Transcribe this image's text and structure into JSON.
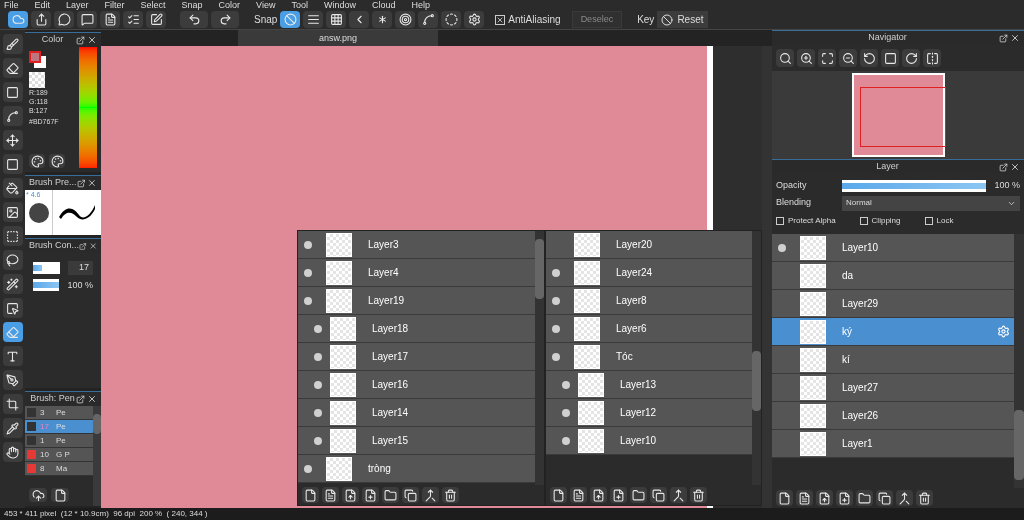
{
  "menu": [
    "File",
    "Edit",
    "Layer",
    "Filter",
    "Select",
    "Snap",
    "Color",
    "View",
    "Tool",
    "Window",
    "Cloud",
    "Help"
  ],
  "toolbar": {
    "snap_label": "Snap",
    "snap_modes": [
      {
        "selected": true
      },
      {
        "selected": false
      },
      {
        "selected": false
      },
      {
        "selected": false
      },
      {
        "selected": false
      },
      {
        "selected": false
      },
      {
        "selected": false
      },
      {
        "selected": false
      },
      {
        "selected": false
      }
    ],
    "antialiasing": {
      "label": "AntiAliasing",
      "checked": true
    },
    "deselect": {
      "label": "Deselec",
      "disabled": true
    },
    "key_label": "Key",
    "reset": "Reset"
  },
  "document_tab": {
    "title": "answ.png"
  },
  "tools": [
    {
      "selected": false
    },
    {
      "selected": false
    },
    {
      "selected": false
    },
    {
      "selected": false
    },
    {
      "selected": false
    },
    {
      "selected": false
    },
    {
      "selected": false
    },
    {
      "selected": false
    },
    {
      "selected": false
    },
    {
      "selected": false
    },
    {
      "selected": false
    },
    {
      "selected": false
    },
    {
      "selected": true
    },
    {
      "selected": false
    },
    {
      "selected": false
    },
    {
      "selected": false
    },
    {
      "selected": false
    },
    {
      "selected": false
    }
  ],
  "color_panel": {
    "title": "Color",
    "r": "R:189",
    "g": "G:118",
    "b": "B:127",
    "hex": "#BD767F"
  },
  "brush_preview": {
    "title": "Brush Pre...",
    "size": "* 4.6"
  },
  "brush_control": {
    "title": "Brush Con...",
    "size": {
      "value": "17",
      "level": 0.35
    },
    "opacity": {
      "value": "100 %",
      "level": 1
    }
  },
  "brush_list": {
    "title": "Brush: Pen",
    "items": [
      {
        "size": "3",
        "name": "Pe",
        "color": "#333333",
        "selected": false
      },
      {
        "size": "17",
        "name": "Pe",
        "color": "#333333",
        "selected": true
      },
      {
        "size": "1",
        "name": "Pe",
        "color": "#333333",
        "selected": false
      },
      {
        "size": "10",
        "name": "G P",
        "color": "#e53935",
        "selected": false
      },
      {
        "size": "8",
        "name": "Ma",
        "color": "#e53935",
        "selected": false
      }
    ]
  },
  "navigator": {
    "title": "Navigator"
  },
  "floating_layer_lists": [
    {
      "layers": [
        {
          "name": "Layer3",
          "visible": true,
          "selected": false
        },
        {
          "name": "Layer4",
          "visible": true,
          "selected": false
        },
        {
          "name": "Layer19",
          "visible": true,
          "selected": false,
          "children": [
            {
              "name": "Layer18",
              "visible": true,
              "selected": false
            },
            {
              "name": "Layer17",
              "visible": true,
              "selected": false
            },
            {
              "name": "Layer16",
              "visible": true,
              "selected": false
            },
            {
              "name": "Layer14",
              "visible": true,
              "selected": false
            },
            {
              "name": "Layer15",
              "visible": true,
              "selected": false
            }
          ]
        },
        {
          "name": "tròng",
          "visible": true,
          "selected": false
        }
      ]
    },
    {
      "layers": [
        {
          "name": "Layer20",
          "visible": false,
          "selected": false
        },
        {
          "name": "Layer24",
          "visible": true,
          "selected": false
        },
        {
          "name": "Layer8",
          "visible": true,
          "selected": false
        },
        {
          "name": "Layer6",
          "visible": true,
          "selected": false
        },
        {
          "name": "Tóc",
          "visible": true,
          "selected": false,
          "children": [
            {
              "name": "Layer13",
              "visible": true,
              "selected": false
            },
            {
              "name": "Layer12",
              "visible": true,
              "selected": false
            },
            {
              "name": "Layer10",
              "visible": true,
              "selected": false
            }
          ]
        }
      ]
    }
  ],
  "layer_panel": {
    "title": "Layer",
    "opacity": {
      "label": "Opacity",
      "value": "100 %",
      "level": 1
    },
    "blending": {
      "label": "Blending",
      "value": "Normal"
    },
    "options": [
      {
        "label": "Protect Alpha",
        "checked": false
      },
      {
        "label": "Clipping",
        "checked": false
      },
      {
        "label": "Lock",
        "checked": false
      }
    ],
    "layers": [
      {
        "name": "Layer10",
        "visible": true,
        "selected": false
      },
      {
        "name": "da",
        "visible": false,
        "selected": false
      },
      {
        "name": "Layer29",
        "visible": false,
        "selected": false
      },
      {
        "name": "ký",
        "visible": false,
        "selected": true
      },
      {
        "name": "kí",
        "visible": false,
        "selected": false
      },
      {
        "name": "Layer27",
        "visible": false,
        "selected": false
      },
      {
        "name": "Layer26",
        "visible": false,
        "selected": false
      },
      {
        "name": "Layer1",
        "visible": false,
        "selected": false
      }
    ]
  },
  "status_bar": "453 * 411 pixel  (12 * 10.9cm)  96 dpi  200 %  ( 240, 344 )"
}
